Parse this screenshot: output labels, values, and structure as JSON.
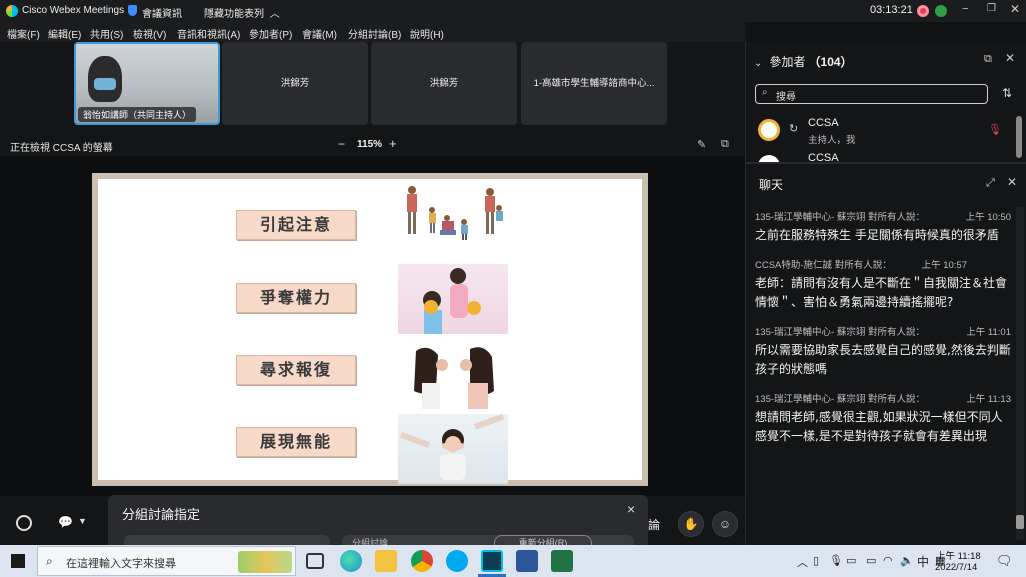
{
  "app": {
    "title": "Cisco Webex Meetings",
    "meeting_info": "會議資訊",
    "hidden_features": "隱藏功能表列",
    "clock": "03:13:21",
    "accent_color": "#00a0d1"
  },
  "menu": [
    "檔案(F)",
    "編輯(E)",
    "共用(S)",
    "檢視(V)",
    "音訊和視訊(A)",
    "參加者(P)",
    "會議(M)",
    "分組討論(B)",
    "說明(H)"
  ],
  "tiles": [
    {
      "label": "翁怡如講師（共同主持人）",
      "active": true
    },
    {
      "label": "洪錦芳"
    },
    {
      "label": "洪錦芳"
    },
    {
      "label": "1-高雄市學生輔導諮商中心..."
    }
  ],
  "view": {
    "viewing": "正在檢視 CCSA 的螢幕",
    "zoom": "115%",
    "zoom_out": "−",
    "zoom_in": "+"
  },
  "slide": {
    "concepts": [
      "引起注意",
      "爭奪權力",
      "尋求報復",
      "展現無能"
    ],
    "pictures": [
      "attention-illustration",
      "power-struggle-photo",
      "revenge-photo",
      "inadequacy-photo"
    ]
  },
  "breakout": {
    "title": "分組討論指定",
    "field_label": "分組討論",
    "button_label": "重新分組(R)",
    "close": "×"
  },
  "bottombar": {
    "right_button": "論"
  },
  "participants": {
    "title": "參加者",
    "count": "（104）",
    "search_placeholder": "搜尋",
    "list": [
      {
        "name": "CCSA",
        "role": "主持人，我"
      },
      {
        "name": "CCSA",
        "role": ""
      }
    ]
  },
  "chat": {
    "title": "聊天",
    "messages": [
      {
        "sender": "135-瑞江學輔中心- 蘇宗翊 對所有人說：",
        "time": "上午 10:50",
        "text": "之前在服務特殊生 手足關係有時候真的很矛盾"
      },
      {
        "sender": "CCSA特助-施仁誠 對所有人說：",
        "time": "上午 10:57",
        "text": "老師：請問有沒有人是不斷在＂自我關注＆社會情懷＂、害怕＆勇氣兩邊持續搖擺呢?"
      },
      {
        "sender": "135-瑞江學輔中心- 蘇宗翊 對所有人說：",
        "time": "上午 11:01",
        "text": "所以需要協助家長去感覺自己的感覺,然後去判斷孩子的狀態嗎"
      },
      {
        "sender": "135-瑞江學輔中心- 蘇宗翊 對所有人說：",
        "time": "上午 11:13",
        "text": "想請問老師,感覺很主觀,如果狀況一樣但不同人感覺不一樣,是不是對待孩子就會有差異出現"
      }
    ]
  },
  "taskbar": {
    "search_placeholder": "在這裡輸入文字來搜尋",
    "ime": "中",
    "time": "上午 11:18",
    "date": "2022/7/14",
    "apps": [
      "task-view",
      "edge",
      "file-explorer",
      "chrome",
      "skype",
      "webex",
      "word",
      "excel"
    ]
  }
}
